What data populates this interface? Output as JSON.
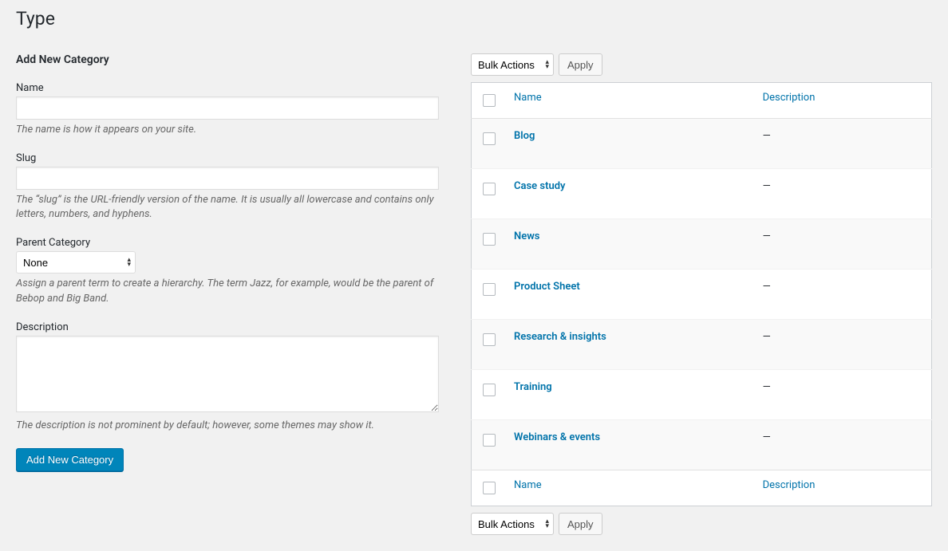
{
  "page": {
    "title": "Type"
  },
  "form": {
    "heading": "Add New Category",
    "name_label": "Name",
    "name_help": "The name is how it appears on your site.",
    "slug_label": "Slug",
    "slug_help": "The “slug” is the URL-friendly version of the name. It is usually all lowercase and contains only letters, numbers, and hyphens.",
    "parent_label": "Parent Category",
    "parent_selected": "None",
    "parent_help": "Assign a parent term to create a hierarchy. The term Jazz, for example, would be the parent of Bebop and Big Band.",
    "description_label": "Description",
    "description_help": "The description is not prominent by default; however, some themes may show it.",
    "submit_label": "Add New Category"
  },
  "bulk": {
    "selected": "Bulk Actions",
    "apply_label": "Apply"
  },
  "table": {
    "col_name": "Name",
    "col_description": "Description",
    "rows": [
      {
        "name": "Blog",
        "description": "—"
      },
      {
        "name": "Case study",
        "description": "—"
      },
      {
        "name": "News",
        "description": "—"
      },
      {
        "name": "Product Sheet",
        "description": "—"
      },
      {
        "name": "Research & insights",
        "description": "—"
      },
      {
        "name": "Training",
        "description": "—"
      },
      {
        "name": "Webinars & events",
        "description": "—"
      }
    ]
  }
}
